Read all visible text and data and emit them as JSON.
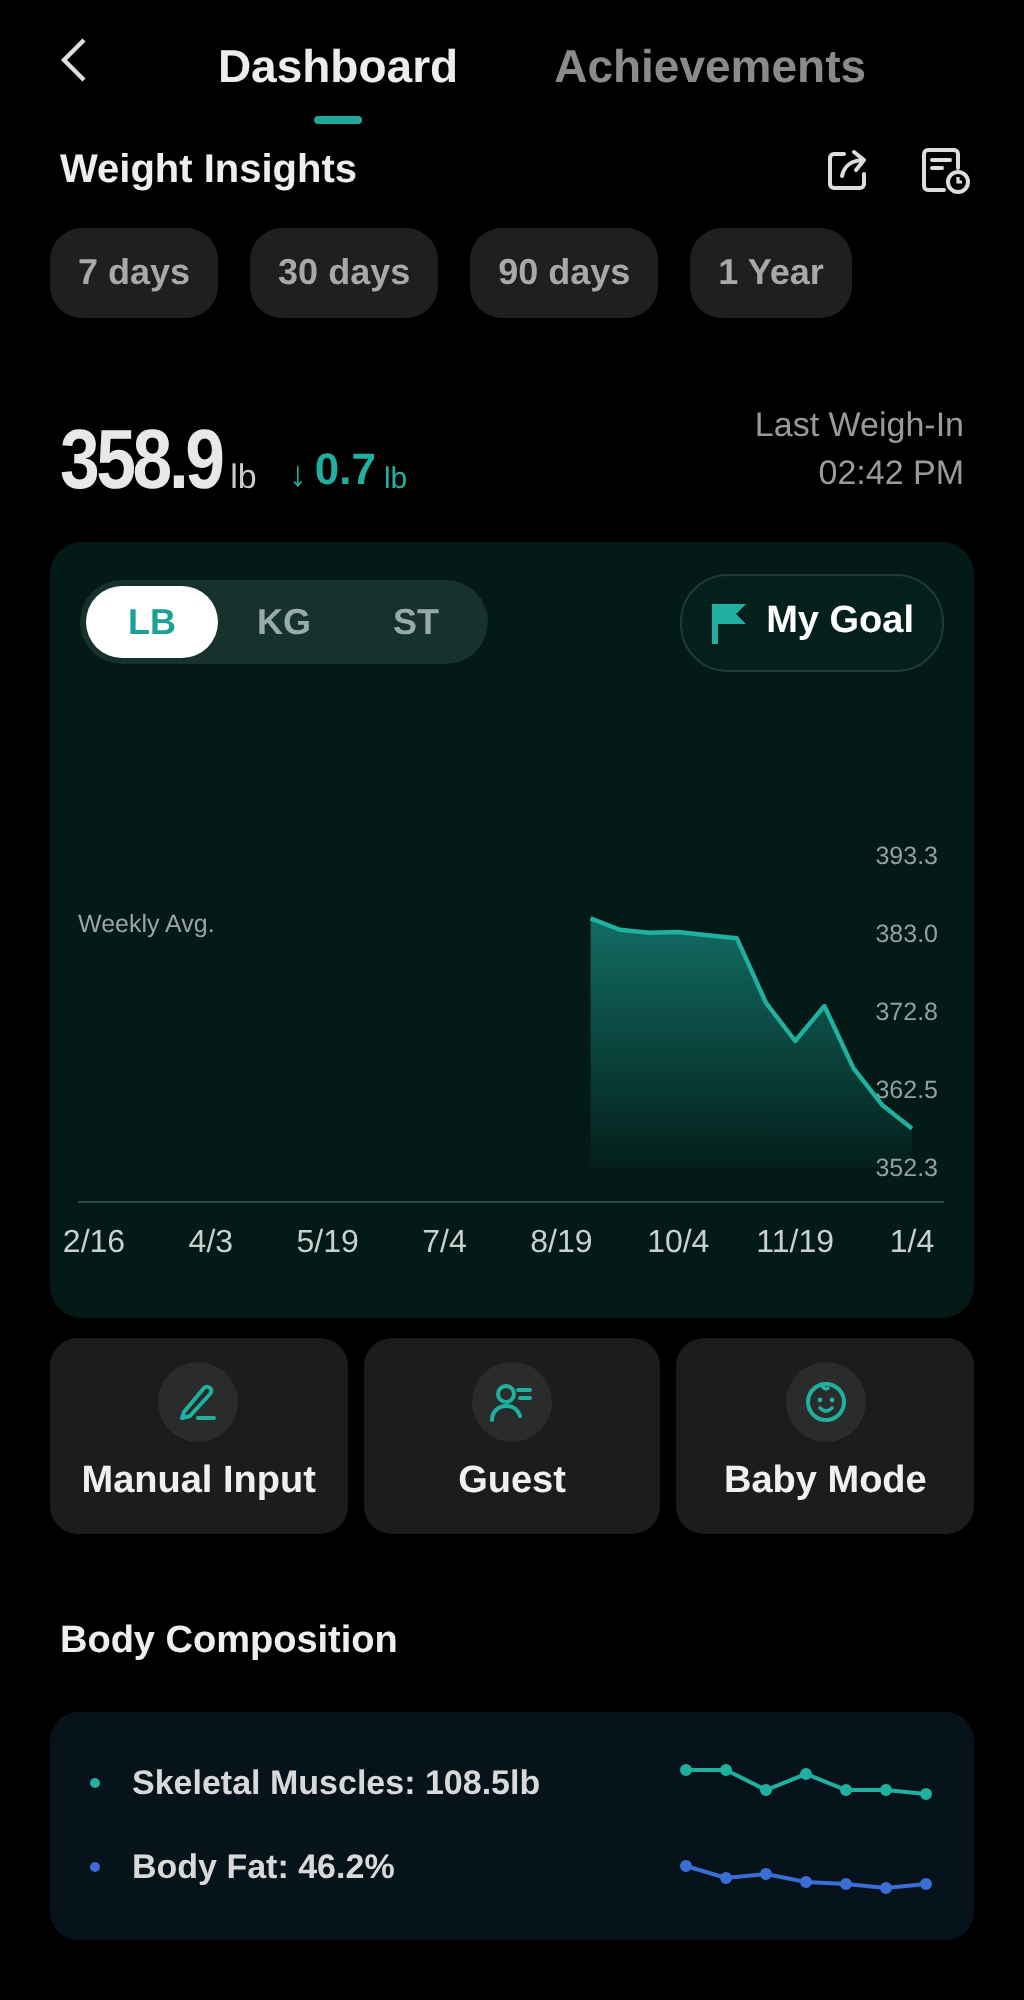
{
  "tabs": [
    {
      "label": "Dashboard",
      "selected": true
    },
    {
      "label": "Achievements",
      "selected": false
    }
  ],
  "section_title": "Weight Insights",
  "periods": [
    {
      "label": "7 days"
    },
    {
      "label": "30 days"
    },
    {
      "label": "90 days"
    },
    {
      "label": "1 Year"
    }
  ],
  "weight": {
    "value": "358.9",
    "unit": "lb",
    "change_arrow": "↓",
    "change": "0.7",
    "change_unit": "lb",
    "last_label": "Last Weigh-In",
    "last_time": "02:42 PM"
  },
  "units": [
    {
      "label": "LB",
      "selected": true
    },
    {
      "label": "KG",
      "selected": false
    },
    {
      "label": "ST",
      "selected": false
    }
  ],
  "goal_button": "My Goal",
  "chart_note": "Weekly Avg.",
  "chart_data": {
    "type": "line",
    "ylim": [
      352.3,
      393.3
    ],
    "yticks": [
      {
        "value": 393.3,
        "label": "393.3"
      },
      {
        "value": 383.0,
        "label": "383.0"
      },
      {
        "value": 372.8,
        "label": "372.8"
      },
      {
        "value": 362.5,
        "label": "362.5"
      },
      {
        "value": 352.3,
        "label": "352.3"
      }
    ],
    "categories": [
      "2/16",
      null,
      null,
      null,
      "4/3",
      null,
      null,
      null,
      "5/19",
      null,
      null,
      null,
      "7/4",
      null,
      null,
      null,
      "8/19",
      null,
      null,
      null,
      "10/4",
      null,
      null,
      null,
      "11/19",
      null,
      null,
      null,
      "1/4"
    ],
    "series": [
      {
        "color": "#1fb0a0",
        "values": [
          null,
          null,
          null,
          null,
          null,
          null,
          null,
          null,
          null,
          null,
          null,
          null,
          null,
          null,
          null,
          null,
          null,
          385.1,
          383.6,
          383.2,
          383.3,
          382.9,
          382.5,
          374.0,
          369.0,
          373.6,
          365.4,
          360.5,
          357.5
        ]
      }
    ]
  },
  "actions": [
    {
      "kind": "pencil",
      "label": "Manual Input"
    },
    {
      "kind": "guest",
      "label": "Guest"
    },
    {
      "kind": "baby",
      "label": "Baby Mode"
    }
  ],
  "composition_title": "Body Composition",
  "composition": [
    {
      "label": "Skeletal Muscles: 108.5lb",
      "color": "#1fb0a0"
    },
    {
      "label": "Body Fat: 46.2%",
      "color": "#3b6fd6"
    }
  ]
}
